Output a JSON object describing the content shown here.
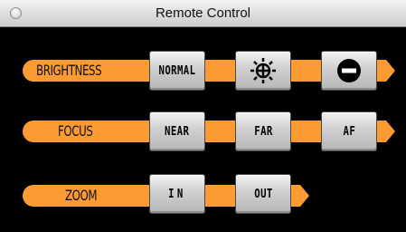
{
  "window": {
    "title": "Remote Control"
  },
  "rows": {
    "brightness": {
      "label": "BRIGHTNESS",
      "buttons": {
        "normal": "NORMAL",
        "brighter": "brightness-up-icon",
        "darker": "brightness-down-icon"
      }
    },
    "focus": {
      "label": "FOCUS",
      "buttons": {
        "near": "NEAR",
        "far": "FAR",
        "af": "AF"
      }
    },
    "zoom": {
      "label": "ZOOM",
      "buttons": {
        "in": "IN",
        "out": "OUT"
      }
    }
  },
  "colors": {
    "strip": "#fb9b32",
    "background": "#000000",
    "button_face": "#cfcfcf"
  }
}
